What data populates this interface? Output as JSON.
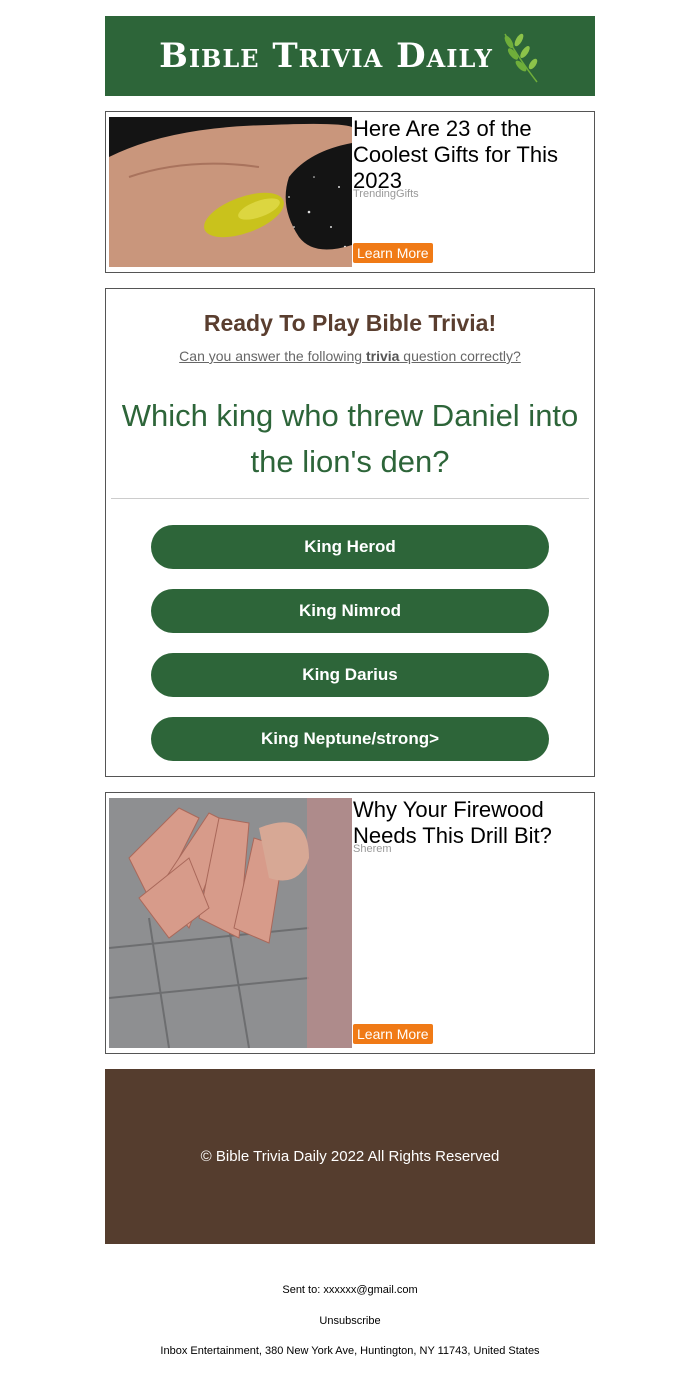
{
  "header": {
    "logo_text": "Bible Trivia Daily",
    "brand_color": "#2d6539"
  },
  "ad_top": {
    "image_icon": "hand-gadget-photo",
    "headline": "Here Are 23 of the Coolest Gifts for This 2023",
    "source": "TrendingGifts",
    "button_label": "Learn More"
  },
  "quiz": {
    "title": "Ready To Play Bible Trivia!",
    "subtitle_pre": "Can you answer the following ",
    "subtitle_bold": "trivia",
    "subtitle_post": " question correctly?",
    "question": "Which king who threw Daniel into the lion's den?",
    "options": [
      "King Herod",
      "King Nimrod",
      "King Darius",
      "King Neptune/strong>"
    ]
  },
  "ad_bottom": {
    "image_icon": "firewood-photo",
    "headline": "Why Your Firewood Needs This Drill Bit?",
    "source": "Sherem",
    "button_label": "Learn More"
  },
  "footer": {
    "copyright": "© Bible Trivia Daily 2022 All Rights Reserved",
    "color": "#553d2e"
  },
  "meta": {
    "sent_to": "Sent to: xxxxxx@gmail.com",
    "unsubscribe": "Unsubscribe",
    "address": "Inbox Entertainment, 380 New York Ave, Huntington, NY 11743, United States"
  }
}
